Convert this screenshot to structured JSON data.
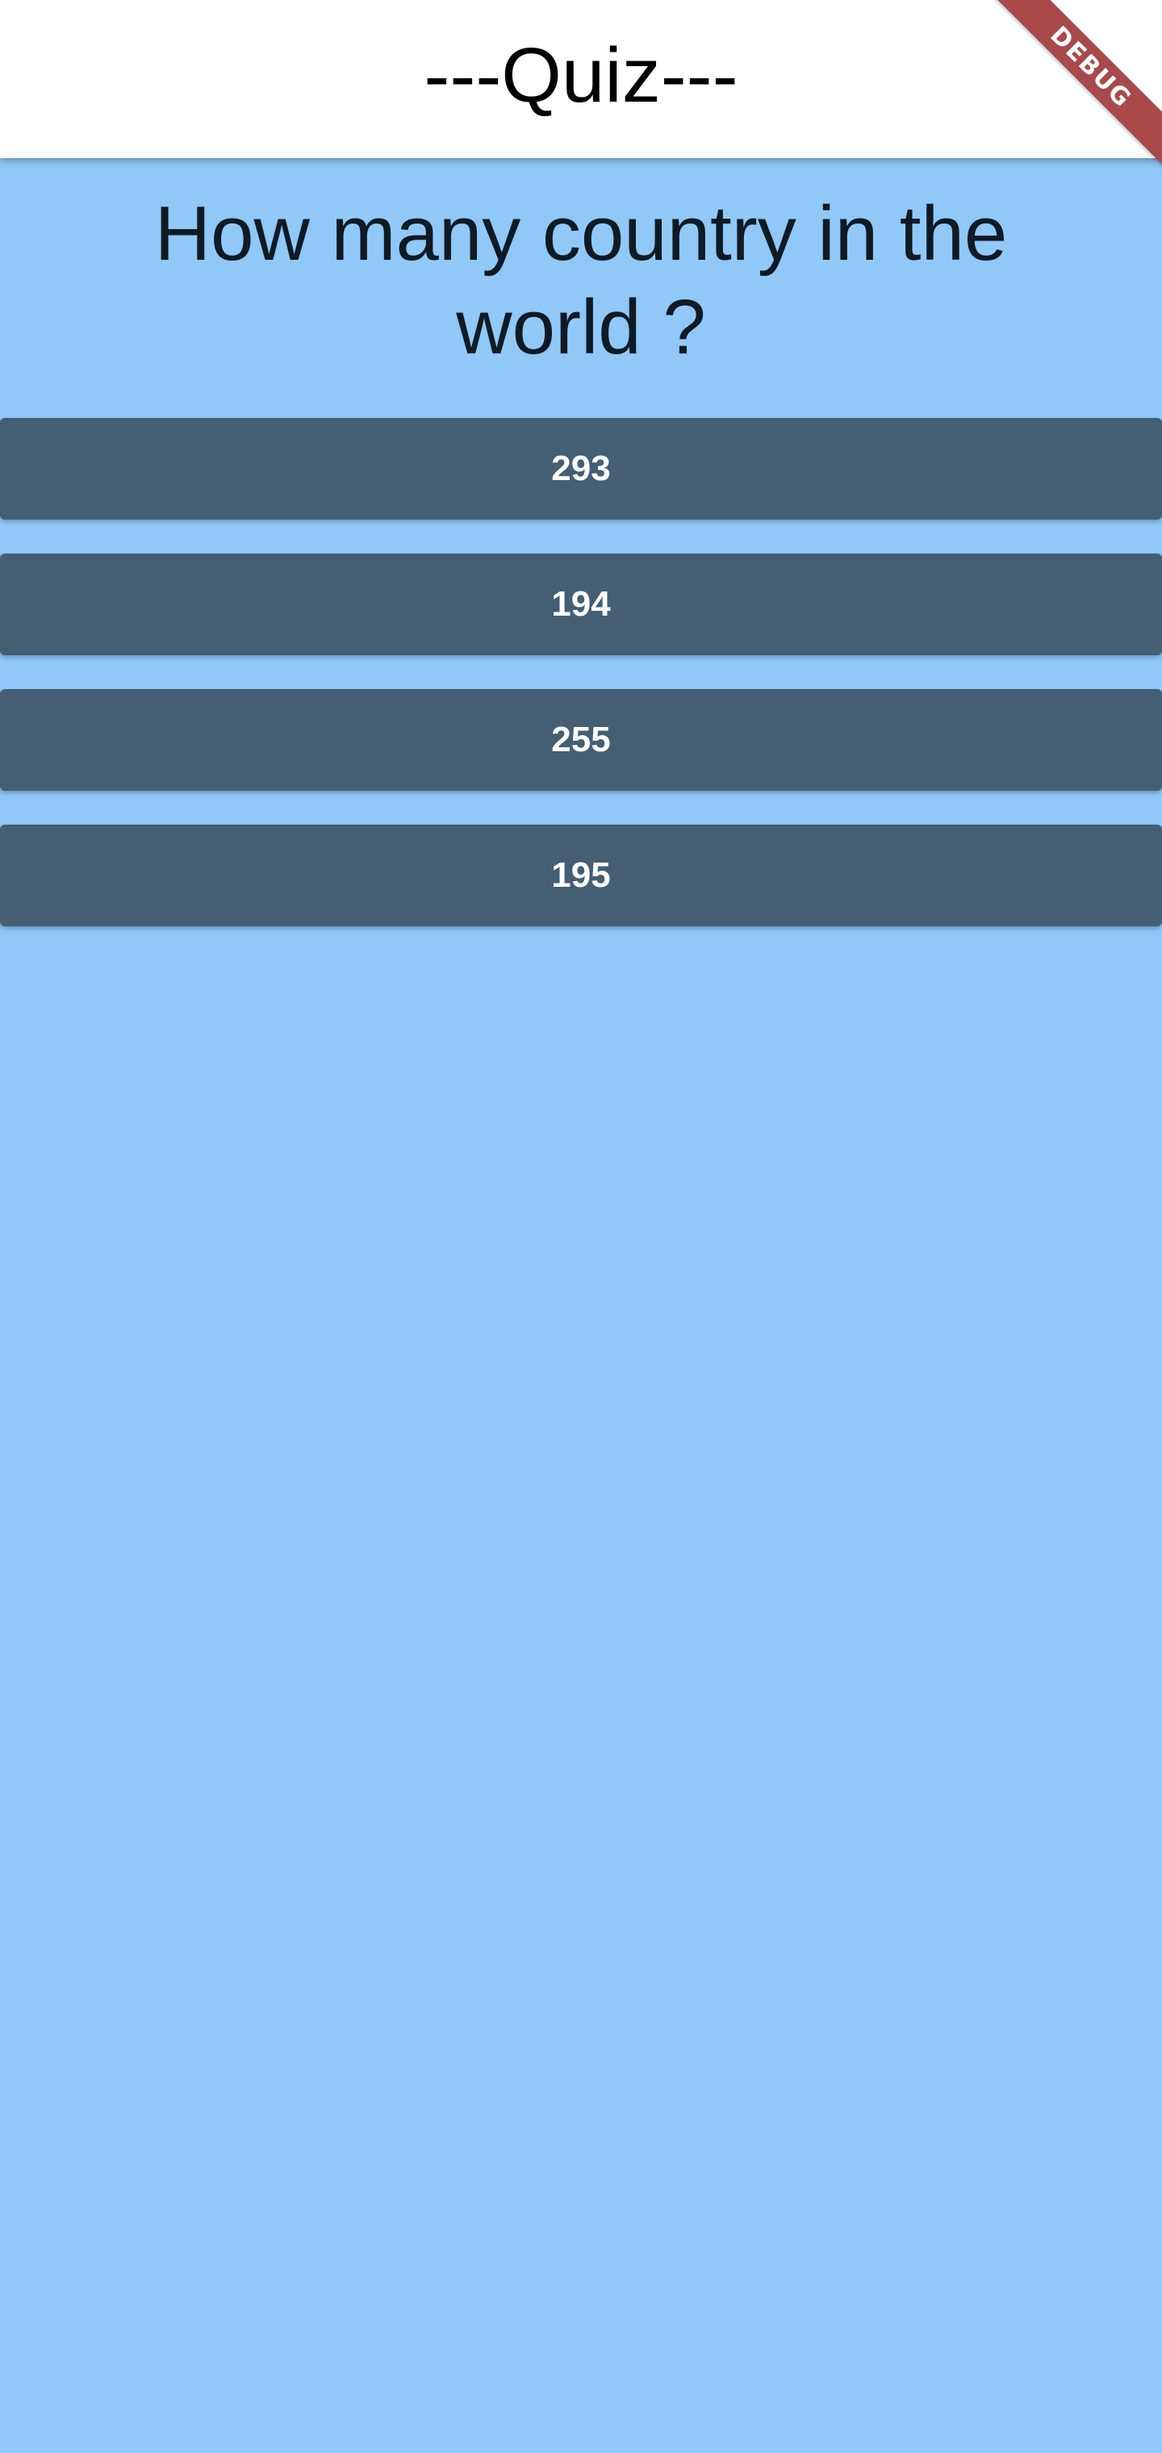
{
  "app_bar": {
    "title": "---Quiz---"
  },
  "debug_banner": {
    "label": "DEBUG"
  },
  "question": {
    "text": "How many country in the world ?"
  },
  "answers": [
    {
      "label": "293"
    },
    {
      "label": "194"
    },
    {
      "label": "255"
    },
    {
      "label": "195"
    }
  ],
  "colors": {
    "background": "#90c8f8",
    "app_bar": "#ffffff",
    "button": "#445e74",
    "button_text": "#ffffff",
    "debug_banner": "#a84a4a"
  }
}
